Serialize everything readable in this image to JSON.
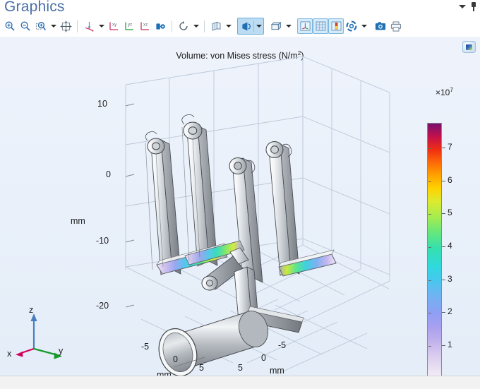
{
  "window": {
    "title": "Graphics",
    "collapse_caret": "chevron-down",
    "pin": "pin"
  },
  "toolbar": {
    "groups": [
      {
        "name": "zoom-group",
        "buttons": [
          {
            "name": "zoom-in",
            "label": "Zoom In",
            "icon": "magnifier-plus-icon",
            "state": "normal"
          },
          {
            "name": "zoom-out",
            "label": "Zoom Out",
            "icon": "magnifier-minus-icon",
            "state": "normal"
          },
          {
            "name": "zoom-box",
            "label": "Zoom Box",
            "icon": "magnifier-box-icon",
            "state": "normal"
          },
          {
            "name": "zoom-box-menu",
            "label": "Zoom Options",
            "icon": "chevron-down-icon",
            "state": "normal"
          },
          {
            "name": "zoom-extents",
            "label": "Zoom Extents",
            "icon": "zoom-extents-icon",
            "state": "normal"
          }
        ]
      },
      {
        "name": "view-group",
        "buttons": [
          {
            "name": "rotate-view",
            "label": "Rotate",
            "icon": "axes-rotate-icon",
            "state": "normal"
          },
          {
            "name": "rotate-view-menu",
            "label": "Rotate Options",
            "icon": "chevron-down-icon",
            "state": "normal"
          },
          {
            "name": "view-xy",
            "label": "Go to XY View",
            "icon": "xy-axes-icon",
            "state": "normal"
          },
          {
            "name": "view-yz",
            "label": "Go to YZ View",
            "icon": "yz-axes-icon",
            "state": "normal"
          },
          {
            "name": "view-xz",
            "label": "Go to XZ View",
            "icon": "xz-axes-icon",
            "state": "normal"
          },
          {
            "name": "default-view",
            "label": "Go to Default 3D View",
            "icon": "default-view-icon",
            "state": "normal"
          }
        ]
      },
      {
        "name": "reset-group",
        "buttons": [
          {
            "name": "reset-view",
            "label": "Reset",
            "icon": "refresh-icon",
            "state": "normal"
          },
          {
            "name": "reset-view-menu",
            "label": "Reset Options",
            "icon": "chevron-down-icon",
            "state": "normal"
          }
        ]
      },
      {
        "name": "transparency-group",
        "buttons": [
          {
            "name": "transparency",
            "label": "Transparency",
            "icon": "transparent-cube-icon",
            "state": "normal"
          },
          {
            "name": "transparency-menu",
            "label": "Transparency Options",
            "icon": "chevron-down-icon",
            "state": "normal"
          }
        ]
      },
      {
        "name": "render-group",
        "buttons": [
          {
            "name": "scene-light",
            "label": "Scene Light",
            "icon": "light-cone-icon",
            "state": "selected"
          },
          {
            "name": "scene-light-menu",
            "label": "Scene Light Options",
            "icon": "chevron-down-icon",
            "state": "selected"
          },
          {
            "name": "select-box",
            "label": "Select Box",
            "icon": "box-select-icon",
            "state": "normal"
          },
          {
            "name": "select-box-menu",
            "label": "Select Box Options",
            "icon": "chevron-down-icon",
            "state": "normal"
          },
          {
            "name": "show-axis-orientation",
            "label": "Show Axis Orientation",
            "icon": "axis-orientation-icon",
            "state": "toggled"
          },
          {
            "name": "show-grid",
            "label": "Show Grid",
            "icon": "grid-icon",
            "state": "toggled"
          },
          {
            "name": "show-color-legend",
            "label": "Show Color Legend",
            "icon": "color-legend-icon",
            "state": "toggled"
          },
          {
            "name": "update-plot",
            "label": "Update Plot",
            "icon": "sync-icon",
            "state": "normal"
          },
          {
            "name": "update-plot-menu",
            "label": "Update Options",
            "icon": "chevron-down-icon",
            "state": "normal"
          },
          {
            "name": "snapshot",
            "label": "Image Snapshot",
            "icon": "camera-icon",
            "state": "normal"
          },
          {
            "name": "print",
            "label": "Print",
            "icon": "printer-icon",
            "state": "normal"
          }
        ]
      }
    ]
  },
  "plot": {
    "title": "Volume: von Mises stress (N/m",
    "title_sup": "2",
    "title_tail": ")",
    "graphics_badge": "graphics-thumbnail-icon"
  },
  "chart_data": {
    "type": "heatmap",
    "title": "Volume: von Mises stress (N/m^2)",
    "plot_kind": "3d-volume-surface",
    "model": "four-bar suspension linkage with cylindrical bushing",
    "colorbar": {
      "multiplier": "×10",
      "multiplier_exp": "7",
      "unit": "N/m^2",
      "ticks": [
        1,
        2,
        3,
        4,
        5,
        6,
        7
      ],
      "tick_labels": [
        "1",
        "2",
        "3",
        "4",
        "5",
        "6",
        "7"
      ],
      "range": [
        0,
        7.8
      ],
      "colormap": "Prism",
      "position": "right",
      "low_color": "#f6f1f8",
      "high_color": "#76126e"
    },
    "axes": {
      "z": {
        "label": "mm",
        "tick_labels": [
          "10",
          "0",
          "-10",
          "-20"
        ],
        "ticks": [
          10,
          0,
          -10,
          -20
        ]
      },
      "x": {
        "label": "mm",
        "tick_labels": [
          "-5",
          "0",
          "5"
        ],
        "ticks": [
          -5,
          0,
          5
        ]
      },
      "y": {
        "label": "mm",
        "tick_labels": [
          "5",
          "0",
          "-5"
        ],
        "ticks": [
          5,
          0,
          -5
        ]
      },
      "grid": true
    },
    "orientation_triad": {
      "x": {
        "label": "x",
        "color": "#d1005a"
      },
      "y": {
        "label": "y",
        "color": "#179a2e"
      },
      "z": {
        "label": "z",
        "color": "#4a7fbf"
      }
    },
    "stress_highlights": [
      {
        "region": "lower cross-beam left",
        "value_approx": 40000000.0
      },
      {
        "region": "lower cross-beam right",
        "value_approx": 30000000.0
      },
      {
        "region": "arm roots",
        "value_approx": 10000000.0
      },
      {
        "region": "bushing cylinder",
        "value_approx": 2000000.0
      }
    ]
  }
}
